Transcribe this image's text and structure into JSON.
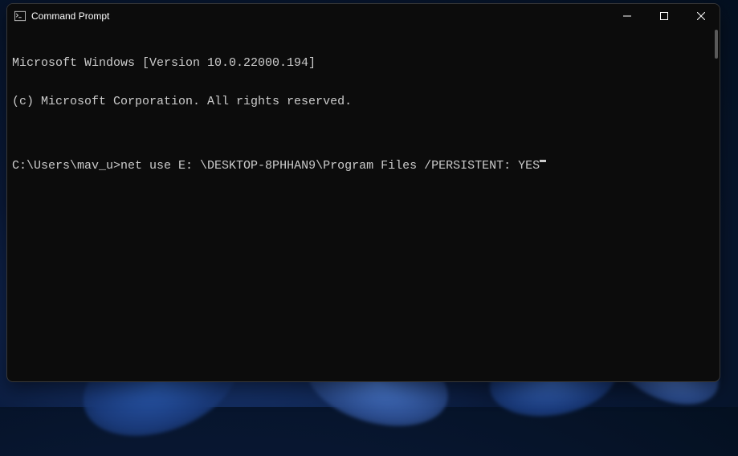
{
  "window": {
    "title": "Command Prompt"
  },
  "terminal": {
    "line1": "Microsoft Windows [Version 10.0.22000.194]",
    "line2": "(c) Microsoft Corporation. All rights reserved.",
    "blank": "",
    "prompt": "C:\\Users\\mav_u>",
    "command": "net use E: \\DESKTOP-8PHHAN9\\Program Files /PERSISTENT: YES"
  }
}
